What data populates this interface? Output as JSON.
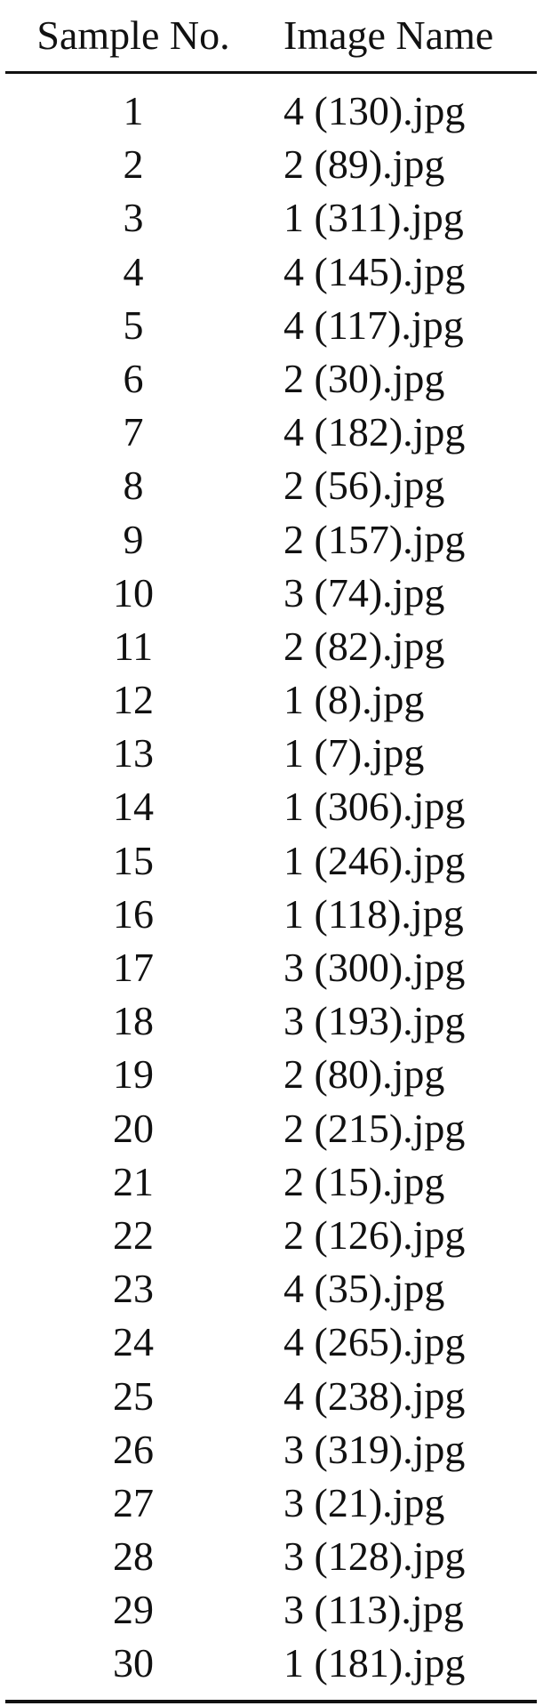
{
  "table": {
    "headers": {
      "sample_no": "Sample No.",
      "image_name": "Image Name"
    },
    "rows": [
      {
        "sample_no": "1",
        "image_name": "4 (130).jpg"
      },
      {
        "sample_no": "2",
        "image_name": "2 (89).jpg"
      },
      {
        "sample_no": "3",
        "image_name": "1 (311).jpg"
      },
      {
        "sample_no": "4",
        "image_name": "4 (145).jpg"
      },
      {
        "sample_no": "5",
        "image_name": "4 (117).jpg"
      },
      {
        "sample_no": "6",
        "image_name": "2 (30).jpg"
      },
      {
        "sample_no": "7",
        "image_name": "4 (182).jpg"
      },
      {
        "sample_no": "8",
        "image_name": "2 (56).jpg"
      },
      {
        "sample_no": "9",
        "image_name": "2 (157).jpg"
      },
      {
        "sample_no": "10",
        "image_name": "3 (74).jpg"
      },
      {
        "sample_no": "11",
        "image_name": "2 (82).jpg"
      },
      {
        "sample_no": "12",
        "image_name": "1 (8).jpg"
      },
      {
        "sample_no": "13",
        "image_name": "1 (7).jpg"
      },
      {
        "sample_no": "14",
        "image_name": "1 (306).jpg"
      },
      {
        "sample_no": "15",
        "image_name": "1 (246).jpg"
      },
      {
        "sample_no": "16",
        "image_name": "1 (118).jpg"
      },
      {
        "sample_no": "17",
        "image_name": "3 (300).jpg"
      },
      {
        "sample_no": "18",
        "image_name": "3 (193).jpg"
      },
      {
        "sample_no": "19",
        "image_name": "2 (80).jpg"
      },
      {
        "sample_no": "20",
        "image_name": "2 (215).jpg"
      },
      {
        "sample_no": "21",
        "image_name": "2 (15).jpg"
      },
      {
        "sample_no": "22",
        "image_name": "2 (126).jpg"
      },
      {
        "sample_no": "23",
        "image_name": "4 (35).jpg"
      },
      {
        "sample_no": "24",
        "image_name": "4 (265).jpg"
      },
      {
        "sample_no": "25",
        "image_name": "4 (238).jpg"
      },
      {
        "sample_no": "26",
        "image_name": "3 (319).jpg"
      },
      {
        "sample_no": "27",
        "image_name": "3 (21).jpg"
      },
      {
        "sample_no": "28",
        "image_name": "3 (128).jpg"
      },
      {
        "sample_no": "29",
        "image_name": "3 (113).jpg"
      },
      {
        "sample_no": "30",
        "image_name": "1 (181).jpg"
      }
    ]
  }
}
